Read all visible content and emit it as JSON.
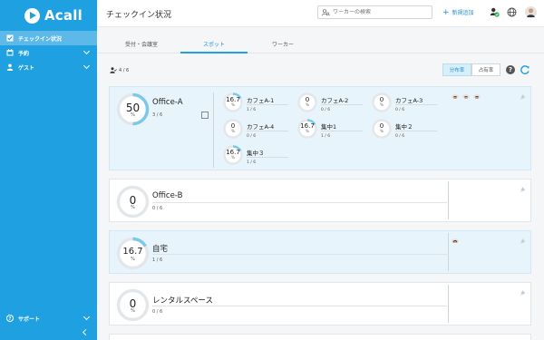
{
  "app": {
    "logo_text": "Acall"
  },
  "sidebar": {
    "items": [
      {
        "label": "チェックイン状況",
        "active": true,
        "icon": "checkbox-icon"
      },
      {
        "label": "予約",
        "icon": "calendar-icon"
      },
      {
        "label": "ゲスト",
        "icon": "person-icon"
      }
    ],
    "support_label": "サポート"
  },
  "header": {
    "title": "チェックイン状況",
    "search_placeholder": "ワーカーの検索",
    "add_label": "新規追加"
  },
  "tabs": [
    {
      "label": "受付・会議室"
    },
    {
      "label": "スポット",
      "active": true
    },
    {
      "label": "ワーカー"
    }
  ],
  "toolbar": {
    "user_count": "4 / 6",
    "segment_distribution": "分布率",
    "segment_occupancy": "占有率",
    "help": "?"
  },
  "cards": [
    {
      "name": "Office-A",
      "value": "50",
      "pct": "%",
      "count": "3 / 6",
      "ratio": 0.5,
      "sub": [
        {
          "name": "カフェA-1",
          "value": "16.7",
          "pct": "%",
          "count": "1 / 6",
          "ratio": 0.167
        },
        {
          "name": "カフェA-2",
          "value": "0",
          "pct": "%",
          "count": "0 / 6",
          "ratio": 0
        },
        {
          "name": "カフェA-3",
          "value": "0",
          "pct": "%",
          "count": "0 / 6",
          "ratio": 0
        },
        {
          "name": "カフェA-4",
          "value": "0",
          "pct": "%",
          "count": "0 / 6",
          "ratio": 0
        },
        {
          "name": "集中1",
          "value": "16.7",
          "pct": "%",
          "count": "1 / 6",
          "ratio": 0.167
        },
        {
          "name": "集中２",
          "value": "0",
          "pct": "%",
          "count": "0 / 6",
          "ratio": 0
        },
        {
          "name": "集中３",
          "value": "16.7",
          "pct": "%",
          "count": "1 / 6",
          "ratio": 0.167
        }
      ]
    },
    {
      "name": "Office-B",
      "value": "0",
      "pct": "%",
      "count": "0 / 6",
      "ratio": 0
    },
    {
      "name": "自宅",
      "value": "16.7",
      "pct": "%",
      "count": "1 / 6",
      "ratio": 0.167
    },
    {
      "name": "レンタルスペース",
      "value": "0",
      "pct": "%",
      "count": "0 / 6",
      "ratio": 0
    }
  ],
  "colors": {
    "accent": "#1fa0e0",
    "ring_fill": "#7cc8ea",
    "ring_track": "#e4e7ea"
  }
}
